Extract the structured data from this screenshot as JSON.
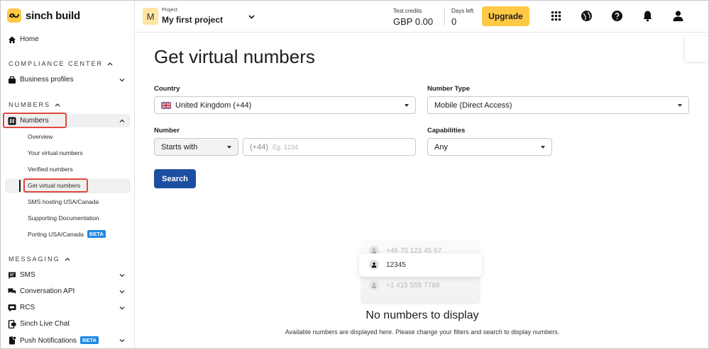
{
  "sidebar": {
    "logo": "sinch build",
    "home": "Home",
    "compliance": {
      "title": "COMPLIANCE CENTER",
      "business_profiles": "Business profiles"
    },
    "numbers_section": {
      "title": "NUMBERS",
      "numbers": "Numbers",
      "items": [
        "Overview",
        "Your virtual numbers",
        "Verified numbers",
        "Get virtual numbers",
        "SMS hosting USA/Canada",
        "Supporting Documentation",
        "Porting USA/Canada"
      ],
      "porting_badge": "BETA"
    },
    "messaging": {
      "title": "MESSAGING",
      "items": [
        "SMS",
        "Conversation API",
        "RCS",
        "Sinch Live Chat",
        "Push Notifications"
      ],
      "push_badge": "BETA"
    }
  },
  "topbar": {
    "project_initial": "M",
    "project_label": "Project",
    "project_name": "My first project",
    "credits_label": "Test credits",
    "credits_value": "GBP 0.00",
    "days_label": "Days left",
    "days_value": "0",
    "upgrade": "Upgrade"
  },
  "main": {
    "title": "Get virtual numbers",
    "country_label": "Country",
    "country_value": "United Kingdom (+44)",
    "number_type_label": "Number Type",
    "number_type_value": "Mobile (Direct Access)",
    "number_label": "Number",
    "number_match": "Starts with",
    "number_prefix": "(+44)",
    "number_placeholder": "Eg. 1234",
    "capabilities_label": "Capabilities",
    "capabilities_value": "Any",
    "search": "Search",
    "empty": {
      "sample_top": "+46 70 123 45 67",
      "sample_mid": "12345",
      "sample_bottom": "+1 415 555 7788",
      "title": "No numbers to display",
      "subtitle": "Available numbers are displayed here. Please change your filters and search to display numbers."
    }
  },
  "colors": {
    "brand_yellow": "#ffc845",
    "primary_blue": "#1b4fa0",
    "beta_blue": "#1e88e5",
    "highlight_red": "#e0473d"
  }
}
